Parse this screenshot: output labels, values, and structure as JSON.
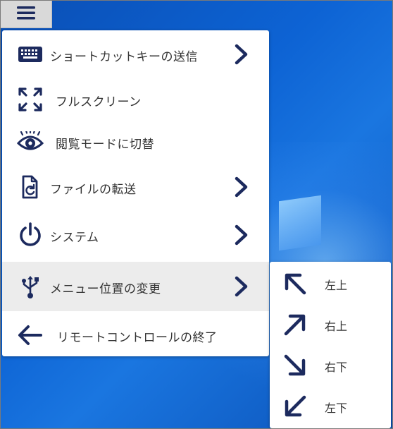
{
  "toolbar": {
    "menu_icon": "hamburger-icon"
  },
  "menu": {
    "items": [
      {
        "label": "ショートカットキーの送信",
        "icon": "keyboard-icon",
        "has_submenu": true
      },
      {
        "label": "フルスクリーン",
        "icon": "fullscreen-icon",
        "has_submenu": false
      },
      {
        "label": "閲覧モードに切替",
        "icon": "eye-icon",
        "has_submenu": false
      },
      {
        "label": "ファイルの転送",
        "icon": "file-transfer-icon",
        "has_submenu": true
      },
      {
        "label": "システム",
        "icon": "power-icon",
        "has_submenu": true
      },
      {
        "label": "メニュー位置の変更",
        "icon": "move-icon",
        "has_submenu": true,
        "active": true
      },
      {
        "label": "リモートコントロールの終了",
        "icon": "arrow-left-icon",
        "has_submenu": false
      }
    ]
  },
  "submenu": {
    "items": [
      {
        "label": "左上",
        "icon": "arrow-up-left-icon"
      },
      {
        "label": "右上",
        "icon": "arrow-up-right-icon"
      },
      {
        "label": "右下",
        "icon": "arrow-down-right-icon"
      },
      {
        "label": "左下",
        "icon": "arrow-down-left-icon"
      }
    ]
  },
  "colors": {
    "icon_navy": "#1c2a5e",
    "menu_bg": "#ffffff",
    "active_bg": "#ececec",
    "desktop_blue": "#0d63d4"
  }
}
